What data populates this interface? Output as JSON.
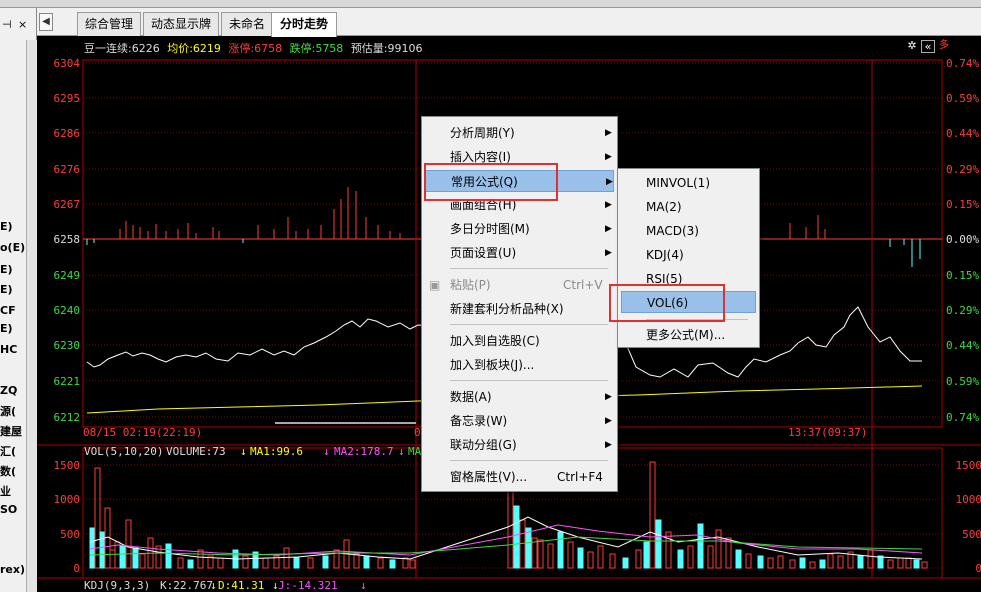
{
  "tabs": [
    "综合管理",
    "动态显示牌",
    "未命名",
    "分时走势"
  ],
  "left_list": [
    "E)",
    "o(E)",
    "E)",
    "E)",
    "CF",
    "E)",
    "HC",
    "ZQ",
    "源(",
    "建屋",
    "汇(",
    "数(",
    "业",
    "SO",
    "rex)"
  ],
  "header": {
    "contract": "豆一连续:6226",
    "avg": "均价:6219",
    "limit_up": "涨停:6758",
    "limit_down": "跌停:5758",
    "est_volume": "预估量:99106"
  },
  "price_axis": [
    "6304",
    "6295",
    "6286",
    "6276",
    "6267",
    "6258",
    "6249",
    "6240",
    "6230",
    "6221",
    "6212"
  ],
  "pct_axis": [
    "0.74%",
    "0.59%",
    "0.44%",
    "0.29%",
    "0.15%",
    "0.00%",
    "0.15%",
    "0.29%",
    "0.44%",
    "0.59%",
    "0.74%"
  ],
  "time_labels": {
    "left": "08/15 02:19(22:19)",
    "mid": "0",
    "right": "13:37(09:37)"
  },
  "vol_header": {
    "name": "VOL(5,10,20)",
    "volume": "VOLUME:73",
    "ma1": "MA1:99.6",
    "ma2": "MA2:178.7",
    "ma3": "MA3"
  },
  "vol_axis": [
    "1500",
    "1000",
    "500",
    "0"
  ],
  "kdj_header": {
    "name": "KDJ(9,3,3)",
    "k": "K:22.767",
    "d": "D:41.31",
    "j": "J:-14.321"
  },
  "context_menu": {
    "items": [
      {
        "label": "分析周期(Y)",
        "arrow": "▶"
      },
      {
        "label": "插入内容(I)",
        "arrow": "▶"
      },
      {
        "label": "常用公式(Q)",
        "arrow": "▶"
      },
      {
        "label": "画面组合(H)",
        "arrow": "▶"
      },
      {
        "label": "多日分时图(M)",
        "arrow": "▶"
      },
      {
        "label": "页面设置(U)",
        "arrow": "▶"
      },
      {
        "label": "粘贴(P)",
        "accel": "Ctrl+V"
      },
      {
        "label": "新建套利分析品种(X)"
      },
      {
        "label": "加入到自选股(C)"
      },
      {
        "label": "加入到板块(J)..."
      },
      {
        "label": "数据(A)",
        "arrow": "▶"
      },
      {
        "label": "备忘录(W)",
        "arrow": "▶"
      },
      {
        "label": "联动分组(G)",
        "arrow": "▶"
      },
      {
        "label": "窗格属性(V)...",
        "accel": "Ctrl+F4"
      }
    ]
  },
  "submenu": {
    "items": [
      "MINVOL(1)",
      "MA(2)",
      "MACD(3)",
      "KDJ(4)",
      "RSI(5)",
      "VOL(6)",
      "更多公式(M)..."
    ]
  },
  "colors": {
    "bg": "#000000",
    "grid": "#b00000",
    "price_red": "#ff3c3c",
    "price_green": "#3cdc3c",
    "yellow": "#ffff00",
    "cyan": "#5ff",
    "magenta": "#ff50ff",
    "highlight": "#99c0e8",
    "annotation": "#e03030"
  }
}
